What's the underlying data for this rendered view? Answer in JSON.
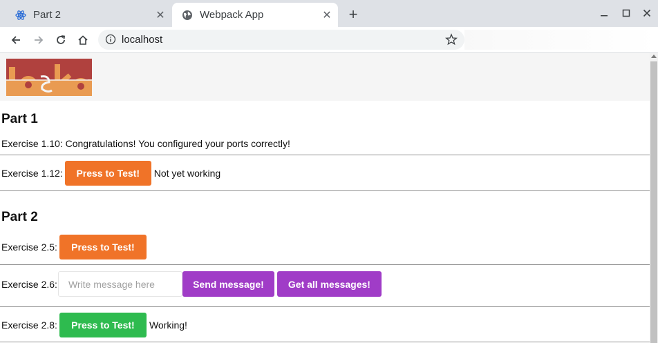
{
  "browser": {
    "tabs": [
      {
        "title": "Part 2",
        "close": "✕"
      },
      {
        "title": "Webpack App",
        "close": "✕"
      }
    ],
    "new_tab": "+",
    "address": "localhost"
  },
  "page": {
    "logo_text": "toska",
    "part1": {
      "title": "Part 1",
      "ex110": "Exercise 1.10: Congratulations! You configured your ports correctly!",
      "ex112_label": "Exercise 1.12:",
      "ex112_button": "Press to Test!",
      "ex112_status": "Not yet working"
    },
    "part2": {
      "title": "Part 2",
      "ex25_label": "Exercise 2.5:",
      "ex25_button": "Press to Test!",
      "ex26_label": "Exercise 2.6:",
      "ex26_placeholder": "Write message here",
      "ex26_send": "Send message!",
      "ex26_getall": "Get all messages!",
      "ex28_label": "Exercise 2.8:",
      "ex28_button": "Press to Test!",
      "ex28_status": "Working!"
    }
  },
  "colors": {
    "orange": "#f07328",
    "green": "#2ebb4f",
    "purple": "#a03cc7",
    "logo_red": "#b0413e",
    "logo_orange": "#e99b52"
  }
}
